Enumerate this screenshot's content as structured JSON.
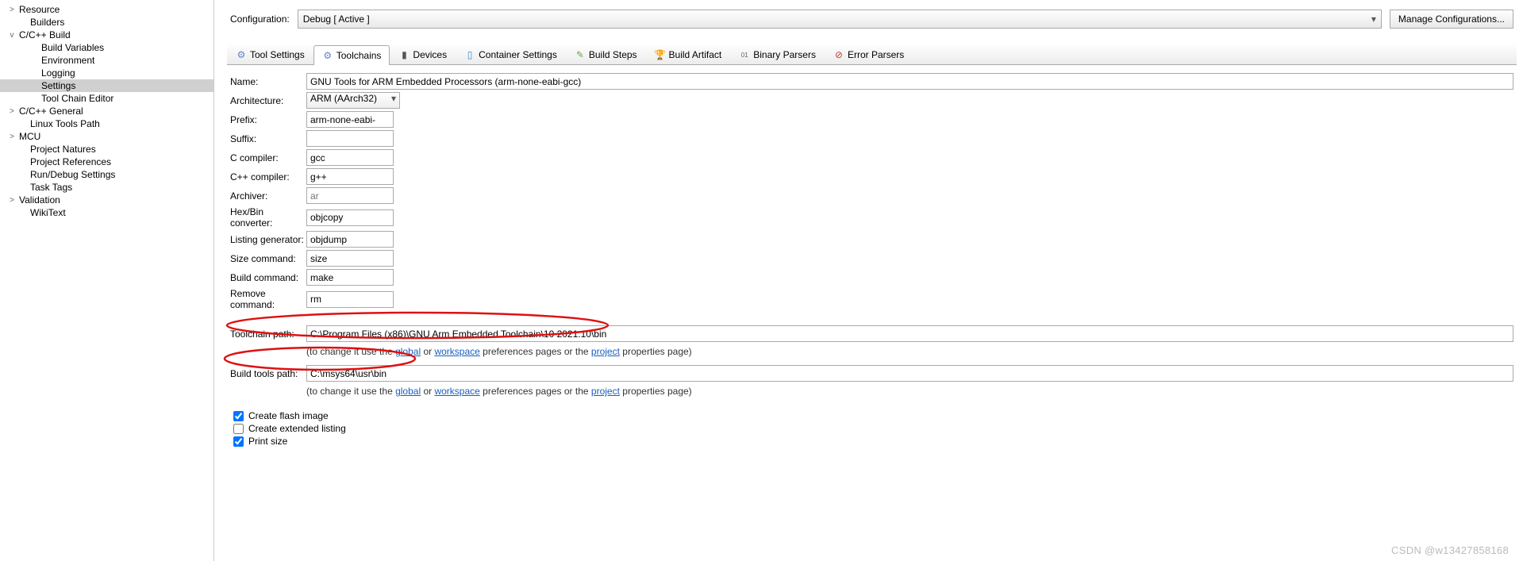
{
  "sidebar": {
    "items": [
      {
        "label": "Resource",
        "toggle": ">",
        "indent": 0
      },
      {
        "label": "Builders",
        "toggle": "",
        "indent": 1
      },
      {
        "label": "C/C++ Build",
        "toggle": "v",
        "indent": 0
      },
      {
        "label": "Build Variables",
        "toggle": "",
        "indent": 2
      },
      {
        "label": "Environment",
        "toggle": "",
        "indent": 2
      },
      {
        "label": "Logging",
        "toggle": "",
        "indent": 2
      },
      {
        "label": "Settings",
        "toggle": "",
        "indent": 2,
        "selected": true
      },
      {
        "label": "Tool Chain Editor",
        "toggle": "",
        "indent": 2
      },
      {
        "label": "C/C++ General",
        "toggle": ">",
        "indent": 0
      },
      {
        "label": "Linux Tools Path",
        "toggle": "",
        "indent": 1
      },
      {
        "label": "MCU",
        "toggle": ">",
        "indent": 0
      },
      {
        "label": "Project Natures",
        "toggle": "",
        "indent": 1
      },
      {
        "label": "Project References",
        "toggle": "",
        "indent": 1
      },
      {
        "label": "Run/Debug Settings",
        "toggle": "",
        "indent": 1
      },
      {
        "label": "Task Tags",
        "toggle": "",
        "indent": 1
      },
      {
        "label": "Validation",
        "toggle": ">",
        "indent": 0
      },
      {
        "label": "WikiText",
        "toggle": "",
        "indent": 1
      }
    ]
  },
  "config": {
    "label": "Configuration:",
    "value": "Debug  [ Active ]",
    "manage": "Manage Configurations..."
  },
  "tabs": [
    {
      "icon": "⚙",
      "label": "Tool Settings",
      "color": "#5a87c7"
    },
    {
      "icon": "⚙",
      "label": "Toolchains",
      "color": "#5a87c7",
      "active": true
    },
    {
      "icon": "▮",
      "label": "Devices",
      "color": "#555"
    },
    {
      "icon": "▯",
      "label": "Container Settings",
      "color": "#3a8fce"
    },
    {
      "icon": "✎",
      "label": "Build Steps",
      "color": "#6aa84f"
    },
    {
      "icon": "🏆",
      "label": "Build Artifact",
      "color": "#d4a017"
    },
    {
      "icon": "01",
      "label": "Binary Parsers",
      "color": "#666",
      "small": true
    },
    {
      "icon": "⊘",
      "label": "Error Parsers",
      "color": "#c0392b"
    }
  ],
  "form": {
    "name": {
      "label": "Name:",
      "value": "GNU Tools for ARM Embedded Processors (arm-none-eabi-gcc)"
    },
    "architecture": {
      "label": "Architecture:",
      "value": "ARM (AArch32)"
    },
    "prefix": {
      "label": "Prefix:",
      "value": "arm-none-eabi-"
    },
    "suffix": {
      "label": "Suffix:",
      "value": ""
    },
    "c_compiler": {
      "label": "C compiler:",
      "value": "gcc"
    },
    "cpp_compiler": {
      "label": "C++ compiler:",
      "value": "g++"
    },
    "archiver": {
      "label": "Archiver:",
      "value": "ar",
      "readonly": true
    },
    "hexbin": {
      "label": "Hex/Bin converter:",
      "value": "objcopy"
    },
    "listing": {
      "label": "Listing generator:",
      "value": "objdump"
    },
    "size_cmd": {
      "label": "Size command:",
      "value": "size"
    },
    "build_cmd": {
      "label": "Build command:",
      "value": "make"
    },
    "remove_cmd": {
      "label": "Remove command:",
      "value": "rm"
    },
    "toolchain_path": {
      "label": "Toolchain path:",
      "value": "C:\\Program Files (x86)\\GNU Arm Embedded Toolchain\\10 2021.10\\bin"
    },
    "build_tools_path": {
      "label": "Build tools path:",
      "value": "C:\\msys64\\usr\\bin"
    }
  },
  "hint": {
    "pre": "(to change it use the ",
    "global": "global",
    "or": " or ",
    "workspace": "workspace",
    "mid": " preferences pages or the ",
    "project": "project",
    "post": " properties page)"
  },
  "checks": {
    "flash": {
      "label": "Create flash image",
      "checked": true
    },
    "listing": {
      "label": "Create extended listing",
      "checked": false
    },
    "size": {
      "label": "Print size",
      "checked": true
    }
  },
  "watermark": "CSDN @w13427858168"
}
